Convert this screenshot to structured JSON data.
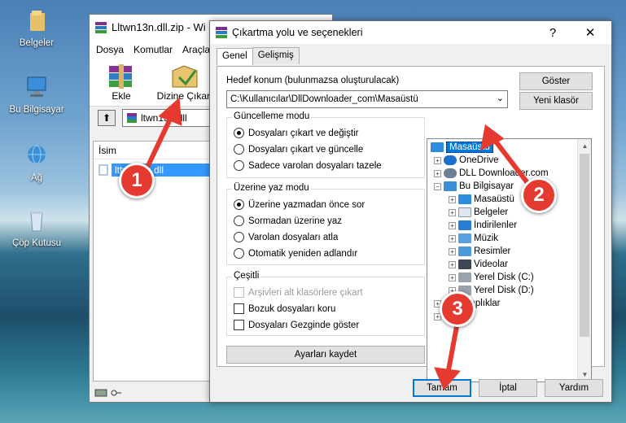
{
  "desktop": {
    "icons": [
      {
        "label": "Belgeler",
        "icon": "folder-icon"
      },
      {
        "label": "Bu Bilgisayar",
        "icon": "computer-icon"
      },
      {
        "label": "Ağ",
        "icon": "network-icon"
      },
      {
        "label": "Çöp Kutusu",
        "icon": "recycle-bin-icon"
      }
    ]
  },
  "winrar": {
    "title": "Lltwn13n.dll.zip - Wi",
    "menu": [
      "Dosya",
      "Komutlar",
      "Araçla"
    ],
    "toolbar": {
      "add_label": "Ekle",
      "extract_label": "Dizine Çıkart"
    },
    "path": "ltwn13n.dll",
    "column_name": "İsim",
    "file": "lttwn13n.dll"
  },
  "dialog": {
    "title": "Çıkartma yolu ve seçenekleri",
    "help_symbol": "?",
    "close_symbol": "✕",
    "tabs": [
      "Genel",
      "Gelişmiş"
    ],
    "dest_label": "Hedef konum (bulunmazsa oluşturulacak)",
    "dest_value": "C:\\Kullanıcılar\\DllDownloader_com\\Masaüstü",
    "show_button": "Göster",
    "new_folder_button": "Yeni klasör",
    "update_mode": {
      "title": "Güncelleme modu",
      "options": [
        "Dosyaları çıkart ve değiştir",
        "Dosyaları çıkart ve güncelle",
        "Sadece varolan dosyaları tazele"
      ],
      "selected": 0
    },
    "overwrite_mode": {
      "title": "Üzerine yaz modu",
      "options": [
        "Üzerine yazmadan önce sor",
        "Sormadan üzerine yaz",
        "Varolan dosyaları atla",
        "Otomatik yeniden adlandır"
      ],
      "selected": 0
    },
    "misc": {
      "title": "Çeşitli",
      "options": [
        "Arşivleri alt klasörlere çıkart",
        "Bozuk dosyaları koru",
        "Dosyaları Gezginde göster"
      ]
    },
    "save_settings_button": "Ayarları kaydet",
    "tree": [
      {
        "label": "Masaüstü",
        "selected": true
      },
      {
        "label": "OneDrive"
      },
      {
        "label": "DLL Downloader.com"
      },
      {
        "label": "Bu Bilgisayar"
      },
      {
        "label": "Masaüstü"
      },
      {
        "label": "Belgeler"
      },
      {
        "label": "İndirilenler"
      },
      {
        "label": "Müzik"
      },
      {
        "label": "Resimler"
      },
      {
        "label": "Videolar"
      },
      {
        "label": "Yerel Disk (C:)"
      },
      {
        "label": "Yerel Disk (D:)"
      },
      {
        "label": "Kitaplıklar"
      },
      {
        "label": "Ağ"
      }
    ],
    "ok_button": "Tamam",
    "cancel_button": "İptal",
    "help_button": "Yardım"
  },
  "annotations": {
    "step1": "1",
    "step2": "2",
    "step3": "3",
    "color": "#e43a2f"
  }
}
